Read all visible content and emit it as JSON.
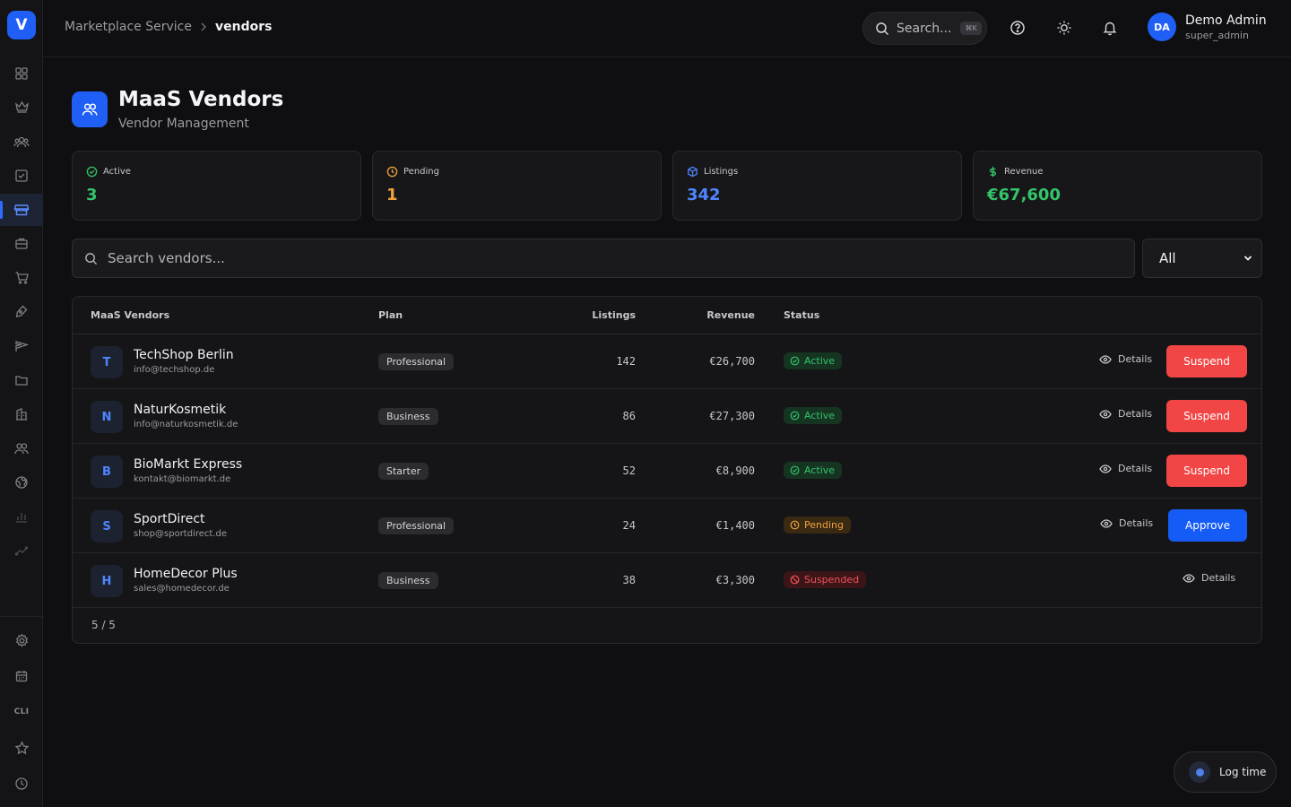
{
  "app": {
    "logo_letter": "V"
  },
  "breadcrumb": {
    "parent": "Marketplace Service",
    "current": "vendors"
  },
  "header": {
    "search_label": "Search...",
    "search_shortcut": "⌘K",
    "user": {
      "initials": "DA",
      "name": "Demo Admin",
      "role": "super_admin"
    }
  },
  "sidebar": {
    "cli_label": "CLI",
    "active_item": "vendors",
    "items": [
      "dashboard-icon",
      "crown-icon",
      "users-group-icon",
      "checkbox-icon",
      "store-icon",
      "briefcase-icon",
      "cart-icon",
      "pen-tool-icon",
      "send-icon",
      "folder-icon",
      "building-icon",
      "team-icon",
      "globe-icon",
      "bar-chart-icon",
      "trend-icon",
      "settings-icon",
      "calendar-icon",
      "terminal-cli",
      "star-icon",
      "clock-icon"
    ]
  },
  "page": {
    "title": "MaaS Vendors",
    "subtitle": "Vendor Management"
  },
  "stats": [
    {
      "label": "Active",
      "value": "3",
      "color": "#34c46a",
      "icon": "check-circle-icon"
    },
    {
      "label": "Pending",
      "value": "1",
      "color": "#f0a13c",
      "icon": "clock-icon"
    },
    {
      "label": "Listings",
      "value": "342",
      "color": "#4f85ff",
      "icon": "box-icon"
    },
    {
      "label": "Revenue",
      "value": "€67,600",
      "color": "#34c46a",
      "icon": "dollar-icon"
    }
  ],
  "filters": {
    "search_placeholder": "Search vendors...",
    "status_value": "All"
  },
  "table": {
    "columns": {
      "vendor": "MaaS Vendors",
      "plan": "Plan",
      "listings": "Listings",
      "revenue": "Revenue",
      "status": "Status"
    },
    "details_label": "Details",
    "rows": [
      {
        "initial": "T",
        "name": "TechShop Berlin",
        "email": "info@techshop.de",
        "plan": "Professional",
        "listings": "142",
        "revenue": "€26,700",
        "status": "Active",
        "action": "Suspend"
      },
      {
        "initial": "N",
        "name": "NaturKosmetik",
        "email": "info@naturkosmetik.de",
        "plan": "Business",
        "listings": "86",
        "revenue": "€27,300",
        "status": "Active",
        "action": "Suspend"
      },
      {
        "initial": "B",
        "name": "BioMarkt Express",
        "email": "kontakt@biomarkt.de",
        "plan": "Starter",
        "listings": "52",
        "revenue": "€8,900",
        "status": "Active",
        "action": "Suspend"
      },
      {
        "initial": "S",
        "name": "SportDirect",
        "email": "shop@sportdirect.de",
        "plan": "Professional",
        "listings": "24",
        "revenue": "€1,400",
        "status": "Pending",
        "action": "Approve"
      },
      {
        "initial": "H",
        "name": "HomeDecor Plus",
        "email": "sales@homedecor.de",
        "plan": "Business",
        "listings": "38",
        "revenue": "€3,300",
        "status": "Suspended",
        "action": ""
      }
    ],
    "footer": "5 / 5"
  },
  "log_time": {
    "label": "Log time"
  },
  "colors": {
    "accent": "#1f5ff5",
    "danger": "#f24545",
    "success": "#34c46a",
    "warning": "#f0a13c"
  }
}
